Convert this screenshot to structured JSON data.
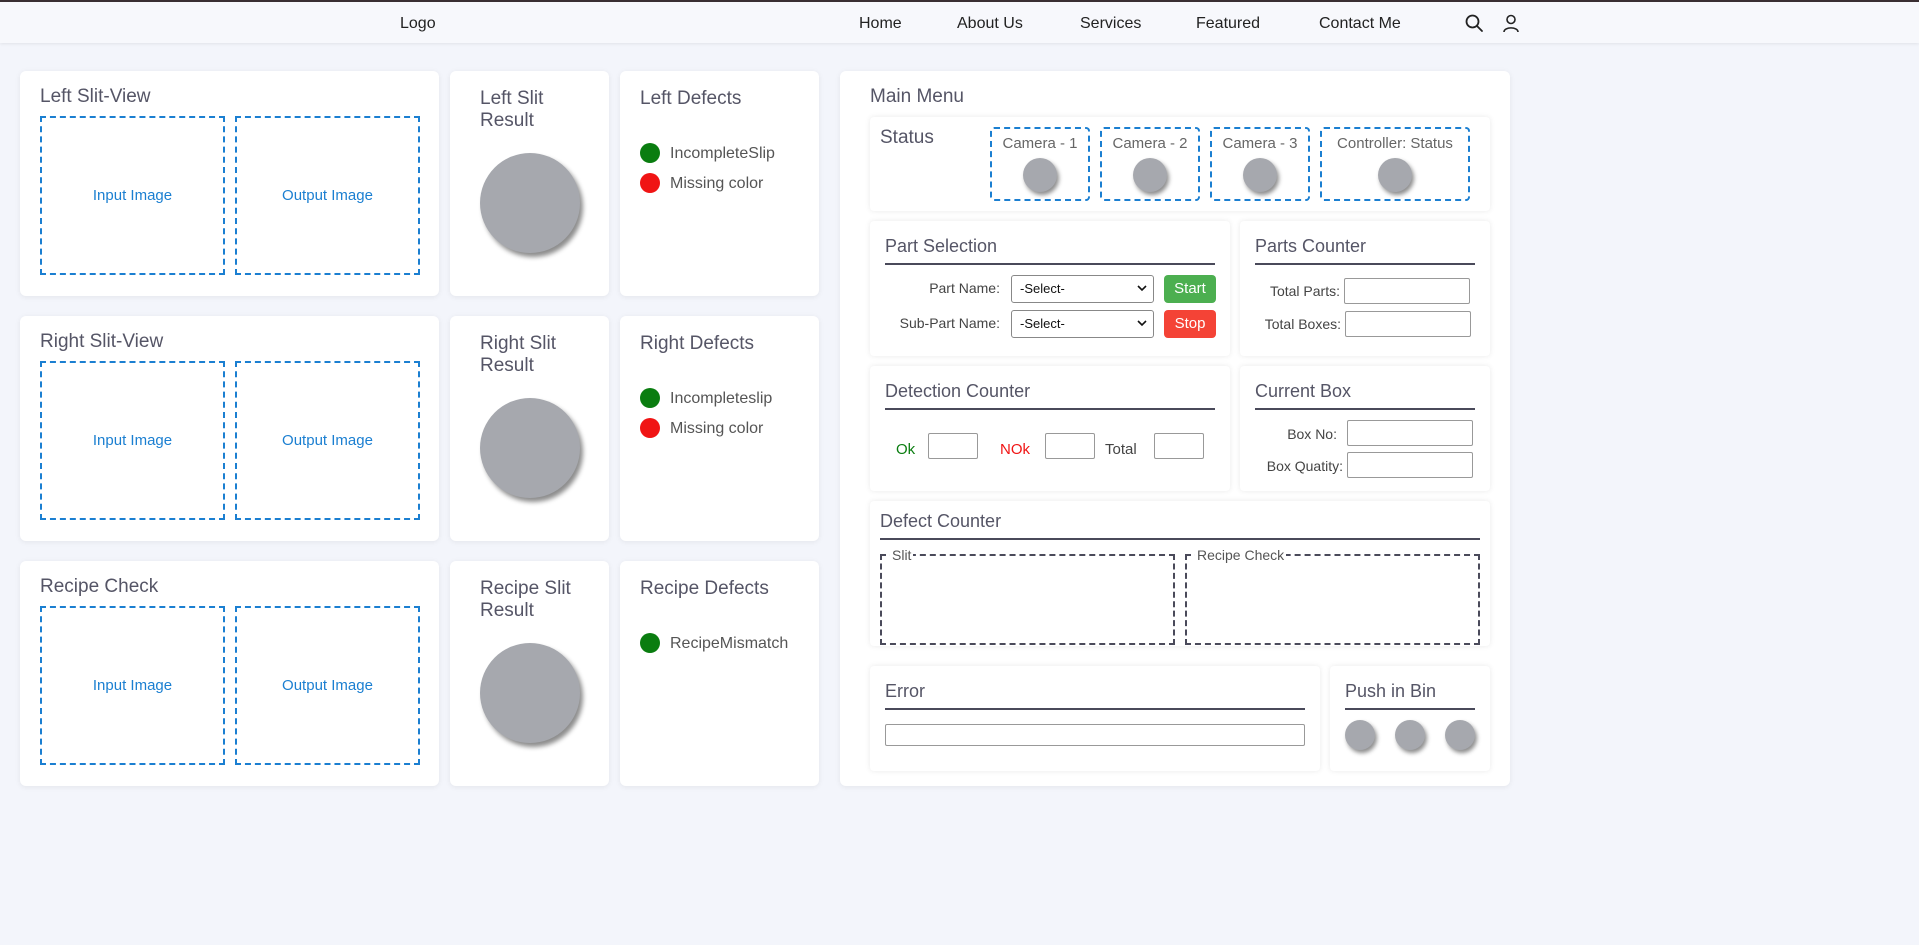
{
  "nav": {
    "logo": "Logo",
    "items": [
      "Home",
      "About Us",
      "Services",
      "Featured",
      "Contact Me"
    ],
    "icons": [
      "search-icon",
      "user-icon"
    ]
  },
  "rows": [
    {
      "view_title": "Left Slit-View",
      "input_label": "Input Image",
      "output_label": "Output Image",
      "result_title": "Left Slit Result",
      "defects_title": "Left Defects",
      "defects": [
        {
          "label": "IncompleteSlip",
          "color": "green"
        },
        {
          "label": "Missing color",
          "color": "red"
        }
      ]
    },
    {
      "view_title": "Right Slit-View",
      "input_label": "Input Image",
      "output_label": "Output Image",
      "result_title": "Right Slit Result",
      "defects_title": "Right Defects",
      "defects": [
        {
          "label": "Incompleteslip",
          "color": "green"
        },
        {
          "label": "Missing color",
          "color": "red"
        }
      ]
    },
    {
      "view_title": "Recipe Check",
      "input_label": "Input Image",
      "output_label": "Output Image",
      "result_title": "Recipe Slit Result",
      "defects_title": "Recipe Defects",
      "defects": [
        {
          "label": "RecipeMismatch",
          "color": "green"
        }
      ]
    }
  ],
  "main_menu": {
    "title": "Main Menu",
    "status": {
      "title": "Status",
      "cameras": [
        "Camera - 1",
        "Camera - 2",
        "Camera - 3",
        "Controller: Status"
      ]
    },
    "part_selection": {
      "title": "Part Selection",
      "part_name_label": "Part Name:",
      "part_name_value": "-Select-",
      "sub_part_label": "Sub-Part Name:",
      "sub_part_value": "-Select-",
      "start_label": "Start",
      "stop_label": "Stop"
    },
    "parts_counter": {
      "title": "Parts Counter",
      "total_parts_label": "Total Parts:",
      "total_boxes_label": "Total Boxes:"
    },
    "detection_counter": {
      "title": "Detection Counter",
      "ok_label": "Ok",
      "nok_label": "NOk",
      "total_label": "Total"
    },
    "current_box": {
      "title": "Current Box",
      "box_no_label": "Box No:",
      "box_qty_label": "Box Quatity:"
    },
    "defect_counter": {
      "title": "Defect Counter",
      "slit_legend": "Slit",
      "recipe_legend": "Recipe Check"
    },
    "error": {
      "title": "Error"
    },
    "push_in_bin": {
      "title": "Push in Bin"
    }
  },
  "colors": {
    "accent_blue": "#1b7fd1",
    "ok_green": "#0a7d10",
    "nok_red": "#f01414",
    "start_button": "#4caf50",
    "stop_button": "#f44336",
    "indicator_grey": "#a6a8ae"
  }
}
